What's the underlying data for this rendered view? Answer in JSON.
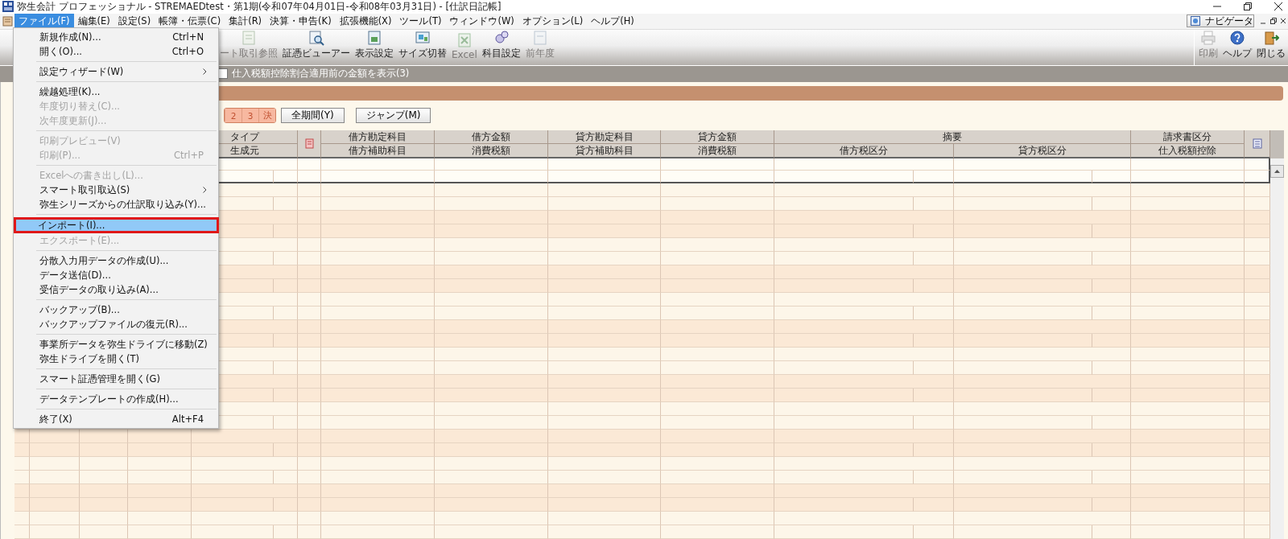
{
  "window": {
    "title": "弥生会計 プロフェッショナル - STREMAEDtest・第1期(令和07年04月01日-令和08年03月31日) - [仕訳日記帳]"
  },
  "menubar": [
    {
      "label": "ファイル(F)",
      "selected": true
    },
    {
      "label": "編集(E)",
      "selected": false
    },
    {
      "label": "設定(S)",
      "selected": false
    },
    {
      "label": "帳簿・伝票(C)",
      "selected": false
    },
    {
      "label": "集計(R)",
      "selected": false
    },
    {
      "label": "決算・申告(K)",
      "selected": false
    },
    {
      "label": "拡張機能(X)",
      "selected": false
    },
    {
      "label": "ツール(T)",
      "selected": false
    },
    {
      "label": "ウィンドウ(W)",
      "selected": false
    },
    {
      "label": "オプション(L)",
      "selected": false
    },
    {
      "label": "ヘルプ(H)",
      "selected": false
    }
  ],
  "navigator": {
    "label": "ナビゲータ"
  },
  "toolbar": {
    "left": [
      {
        "label": "ート取引参照",
        "disabled": true
      },
      {
        "label": "証憑ビューアー",
        "disabled": false
      },
      {
        "label": "表示設定",
        "disabled": false
      },
      {
        "label": "サイズ切替",
        "disabled": false
      },
      {
        "label": "Excel",
        "disabled": true
      },
      {
        "label": "科目設定",
        "disabled": false
      },
      {
        "label": "前年度",
        "disabled": true
      }
    ],
    "right": [
      {
        "label": "印刷",
        "disabled": true
      },
      {
        "label": "ヘルプ",
        "disabled": false
      },
      {
        "label": "閉じる",
        "disabled": false
      }
    ]
  },
  "option_bar": {
    "label": "仕入税額控除割合適用前の金額を表示(3)",
    "checked": false
  },
  "period_tabs": [
    {
      "label": "2",
      "selected": false
    },
    {
      "label": "3",
      "selected": false
    },
    {
      "label": "決",
      "selected": false
    }
  ],
  "period_buttons": [
    "全期間(Y)",
    "ジャンプ(M)"
  ],
  "journal_table": {
    "columns": [
      {
        "kind": "text",
        "top": "タイプ",
        "bottom": "生成元"
      },
      {
        "kind": "icon"
      },
      {
        "kind": "text",
        "top": "借方勘定科目",
        "bottom": "借方補助科目"
      },
      {
        "kind": "text",
        "top": "借方金額",
        "bottom": "消費税額"
      },
      {
        "kind": "text",
        "top": "貸方勘定科目",
        "bottom": "貸方補助科目"
      },
      {
        "kind": "text",
        "top": "貸方金額",
        "bottom": "消費税額"
      },
      {
        "kind": "group",
        "top": "摘要",
        "bottom": [
          "借方税区分",
          "貸方税区分"
        ]
      },
      {
        "kind": "text",
        "top": "請求書区分",
        "bottom": "仕入税額控除"
      },
      {
        "kind": "icon"
      }
    ]
  },
  "file_menu": [
    {
      "kind": "item",
      "label": "新規作成(N)...",
      "shortcut": "Ctrl+N",
      "disabled": false,
      "selected": false,
      "submenu": false,
      "boxed": false
    },
    {
      "kind": "item",
      "label": "開く(O)...",
      "shortcut": "Ctrl+O",
      "disabled": false,
      "selected": false,
      "submenu": false,
      "boxed": false
    },
    {
      "kind": "separator"
    },
    {
      "kind": "item",
      "label": "設定ウィザード(W)",
      "disabled": false,
      "selected": false,
      "submenu": true,
      "boxed": false
    },
    {
      "kind": "separator"
    },
    {
      "kind": "item",
      "label": "繰越処理(K)...",
      "disabled": false,
      "selected": false,
      "submenu": false,
      "boxed": false
    },
    {
      "kind": "item",
      "label": "年度切り替え(C)...",
      "disabled": true,
      "selected": false,
      "submenu": false,
      "boxed": false
    },
    {
      "kind": "item",
      "label": "次年度更新(J)...",
      "disabled": true,
      "selected": false,
      "submenu": false,
      "boxed": false
    },
    {
      "kind": "separator"
    },
    {
      "kind": "item",
      "label": "印刷プレビュー(V)",
      "disabled": true,
      "selected": false,
      "submenu": false,
      "boxed": false
    },
    {
      "kind": "item",
      "label": "印刷(P)...",
      "shortcut": "Ctrl+P",
      "disabled": true,
      "selected": false,
      "submenu": false,
      "boxed": false
    },
    {
      "kind": "separator"
    },
    {
      "kind": "item",
      "label": "Excelへの書き出し(L)...",
      "disabled": true,
      "selected": false,
      "submenu": false,
      "boxed": false
    },
    {
      "kind": "item",
      "label": "スマート取引取込(S)",
      "disabled": false,
      "selected": false,
      "submenu": true,
      "boxed": false
    },
    {
      "kind": "item",
      "label": "弥生シリーズからの仕訳取り込み(Y)...",
      "disabled": false,
      "selected": false,
      "submenu": false,
      "boxed": false
    },
    {
      "kind": "separator"
    },
    {
      "kind": "item",
      "label": "インポート(I)...",
      "disabled": false,
      "selected": true,
      "submenu": false,
      "boxed": true
    },
    {
      "kind": "item",
      "label": "エクスポート(E)...",
      "disabled": true,
      "selected": false,
      "submenu": false,
      "boxed": false
    },
    {
      "kind": "separator"
    },
    {
      "kind": "item",
      "label": "分散入力用データの作成(U)...",
      "disabled": false,
      "selected": false,
      "submenu": false,
      "boxed": false
    },
    {
      "kind": "item",
      "label": "データ送信(D)...",
      "disabled": false,
      "selected": false,
      "submenu": false,
      "boxed": false
    },
    {
      "kind": "item",
      "label": "受信データの取り込み(A)...",
      "disabled": false,
      "selected": false,
      "submenu": false,
      "boxed": false
    },
    {
      "kind": "separator"
    },
    {
      "kind": "item",
      "label": "バックアップ(B)...",
      "disabled": false,
      "selected": false,
      "submenu": false,
      "boxed": false
    },
    {
      "kind": "item",
      "label": "バックアップファイルの復元(R)...",
      "disabled": false,
      "selected": false,
      "submenu": false,
      "boxed": false
    },
    {
      "kind": "separator"
    },
    {
      "kind": "item",
      "label": "事業所データを弥生ドライブに移動(Z)",
      "disabled": false,
      "selected": false,
      "submenu": false,
      "boxed": false
    },
    {
      "kind": "item",
      "label": "弥生ドライブを開く(T)",
      "disabled": false,
      "selected": false,
      "submenu": false,
      "boxed": false
    },
    {
      "kind": "separator"
    },
    {
      "kind": "item",
      "label": "スマート証憑管理を開く(G)",
      "disabled": false,
      "selected": false,
      "submenu": false,
      "boxed": false
    },
    {
      "kind": "separator"
    },
    {
      "kind": "item",
      "label": "データテンプレートの作成(H)...",
      "disabled": false,
      "selected": false,
      "submenu": false,
      "boxed": false
    },
    {
      "kind": "separator"
    },
    {
      "kind": "item",
      "label": "終了(X)",
      "shortcut": "Alt+F4",
      "disabled": false,
      "selected": false,
      "submenu": false,
      "boxed": false
    }
  ]
}
